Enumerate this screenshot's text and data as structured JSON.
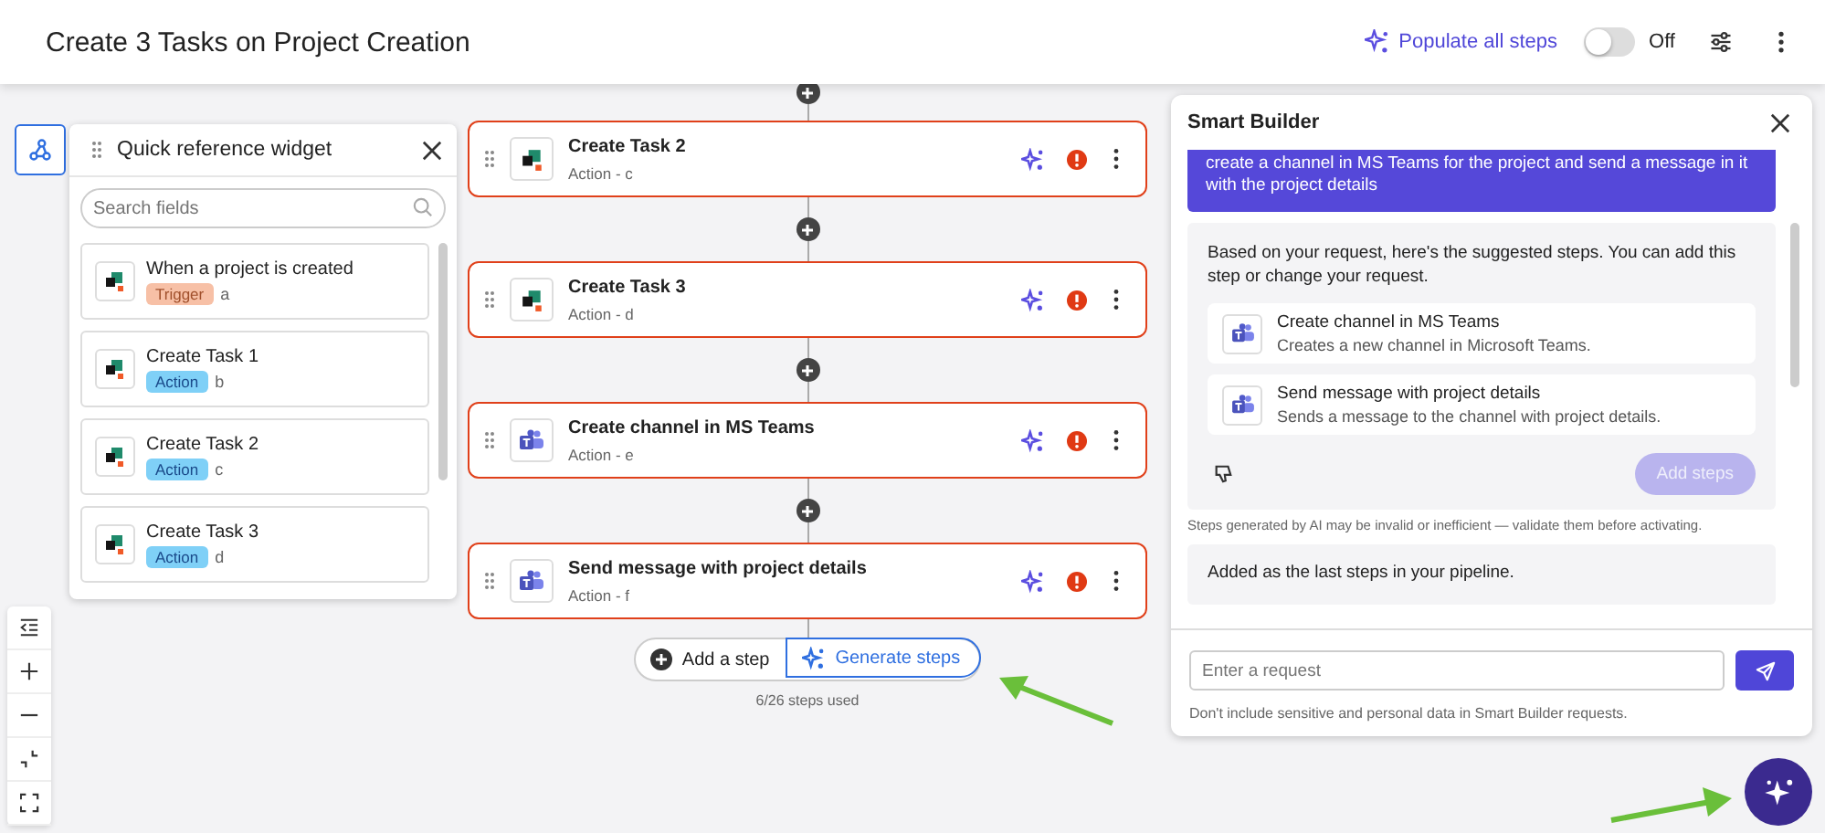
{
  "header": {
    "title": "Create 3 Tasks on Project Creation",
    "populate_label": "Populate all steps",
    "toggle": {
      "on": false,
      "label": "Off"
    }
  },
  "widget": {
    "title": "Quick reference widget",
    "search_placeholder": "Search fields",
    "items": [
      {
        "title": "When a project is created",
        "tag": "Trigger",
        "kind": "trigger",
        "ref": "a"
      },
      {
        "title": "Create Task 1",
        "tag": "Action",
        "kind": "action",
        "ref": "b"
      },
      {
        "title": "Create Task 2",
        "tag": "Action",
        "kind": "action",
        "ref": "c"
      },
      {
        "title": "Create Task 3",
        "tag": "Action",
        "kind": "action",
        "ref": "d"
      }
    ]
  },
  "steps": [
    {
      "title": "Create Task 2",
      "subtitle": "Action - c",
      "kind": "task",
      "error": true
    },
    {
      "title": "Create Task 3",
      "subtitle": "Action - d",
      "kind": "task",
      "error": true
    },
    {
      "title": "Create channel in MS Teams",
      "subtitle": "Action - e",
      "kind": "teams",
      "error": true
    },
    {
      "title": "Send message with project details",
      "subtitle": "Action - f",
      "kind": "teams",
      "error": true
    }
  ],
  "add_step_label": "Add a step",
  "generate_label": "Generate steps",
  "usage": "6/26 steps used",
  "smart_builder": {
    "title": "Smart Builder",
    "user_message": "create a channel in MS Teams for the project and send a message in it with the project details",
    "response": "Based on your request, here's the suggested steps. You can add this step or change your request.",
    "suggestions": [
      {
        "title": "Create channel in MS Teams",
        "description": "Creates a new channel in Microsoft Teams."
      },
      {
        "title": "Send message with project details",
        "description": "Sends a message to the channel with project details."
      }
    ],
    "add_steps": {
      "label": "Add steps",
      "disabled": true
    },
    "disclaimer": "Steps generated by AI may be invalid or inefficient — validate them before activating.",
    "status": "Added as the last steps in your pipeline.",
    "input_placeholder": "Enter a request",
    "note": "Don't include sensitive and personal data in Smart Builder requests."
  }
}
